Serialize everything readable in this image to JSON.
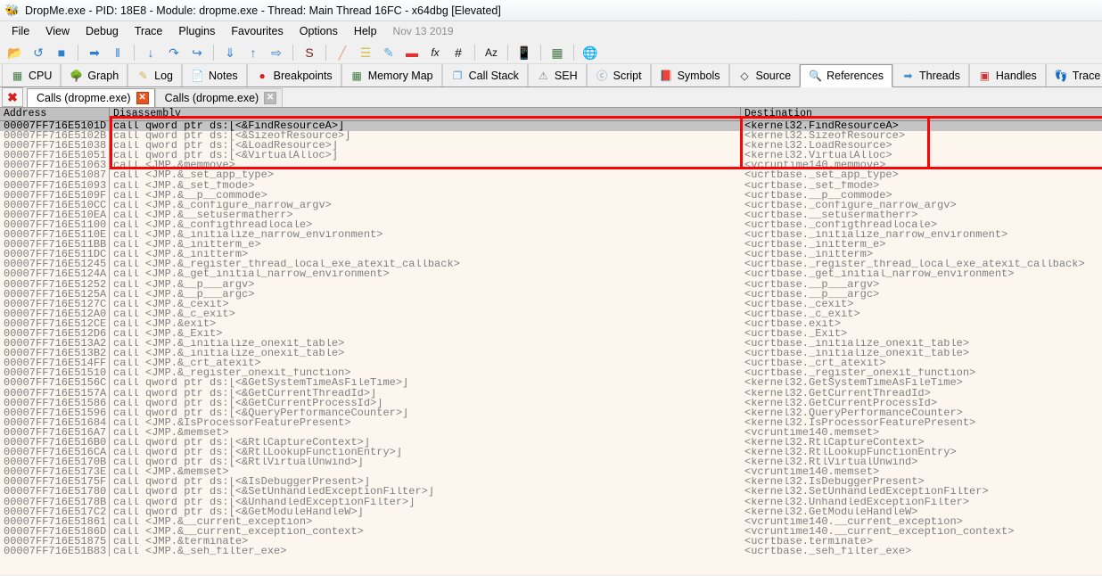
{
  "window": {
    "icon": "bug-icon",
    "title": "DropMe.exe - PID: 18E8 - Module: dropme.exe - Thread: Main Thread 16FC - x64dbg [Elevated]"
  },
  "menubar": {
    "items": [
      "File",
      "View",
      "Debug",
      "Trace",
      "Plugins",
      "Favourites",
      "Options",
      "Help"
    ],
    "date": "Nov 13 2019"
  },
  "toolbar": {
    "buttons": [
      {
        "name": "open-icon",
        "glyph": "📂",
        "color": "#e8b34a"
      },
      {
        "name": "restart-icon",
        "glyph": "↺",
        "color": "#2f7fd0"
      },
      {
        "name": "stop-icon",
        "glyph": "■",
        "color": "#2f7fd0"
      },
      {
        "name": "run-icon",
        "glyph": "➡",
        "color": "#2f7fd0"
      },
      {
        "name": "pause-icon",
        "glyph": "‖",
        "color": "#2f7fd0"
      },
      {
        "name": "step-into-icon",
        "glyph": "↓",
        "color": "#2f7fd0"
      },
      {
        "name": "step-over-icon",
        "glyph": "↷",
        "color": "#2f7fd0"
      },
      {
        "name": "step-out-icon",
        "glyph": "↪",
        "color": "#2f7fd0"
      },
      {
        "name": "run-to-icon",
        "glyph": "⇓",
        "color": "#2f7fd0"
      },
      {
        "name": "execute-till-return-icon",
        "glyph": "↑",
        "color": "#2f7fd0"
      },
      {
        "name": "run-to-user-code-icon",
        "glyph": "⇨",
        "color": "#2f7fd0"
      },
      {
        "name": "scylla-icon",
        "glyph": "S",
        "color": "#7a1b1b"
      },
      {
        "name": "patch-icon",
        "glyph": "╱",
        "color": "#e0a58a"
      },
      {
        "name": "log-window-icon",
        "glyph": "☰",
        "color": "#d8c24a"
      },
      {
        "name": "comment-icon",
        "glyph": "✎",
        "color": "#5aa8d8"
      },
      {
        "name": "bookmark-icon",
        "glyph": "▬",
        "color": "#e03030"
      },
      {
        "name": "function-icon",
        "glyph": "fx",
        "color": "#111111"
      },
      {
        "name": "hash-icon",
        "glyph": "#",
        "color": "#111111"
      },
      {
        "name": "label-icon",
        "glyph": "Az",
        "color": "#111111"
      },
      {
        "name": "attach-icon",
        "glyph": "📱",
        "color": "#6b8db5"
      },
      {
        "name": "calculator-icon",
        "glyph": "▦",
        "color": "#4c7a4c"
      },
      {
        "name": "globe-icon",
        "glyph": "🌐",
        "color": "#2f7fd0"
      }
    ],
    "separators_after": [
      2,
      4,
      7,
      10,
      11,
      17,
      18,
      19,
      20
    ]
  },
  "tabs": {
    "items": [
      {
        "label": "CPU",
        "icon": "cpu-icon",
        "glyph": "▦",
        "color": "#3f7a3f",
        "active": false
      },
      {
        "label": "Graph",
        "icon": "graph-tree-icon",
        "glyph": "🌳",
        "color": "#3f9a3f",
        "active": false
      },
      {
        "label": "Log",
        "icon": "log-icon",
        "glyph": "✎",
        "color": "#d8b24a",
        "active": false
      },
      {
        "label": "Notes",
        "icon": "notes-icon",
        "glyph": "📄",
        "color": "#8fb4d8",
        "active": false
      },
      {
        "label": "Breakpoints",
        "icon": "breakpoint-icon",
        "glyph": "●",
        "color": "#d02020",
        "active": false
      },
      {
        "label": "Memory Map",
        "icon": "memory-map-icon",
        "glyph": "▦",
        "color": "#3f7a3f",
        "active": false
      },
      {
        "label": "Call Stack",
        "icon": "call-stack-icon",
        "glyph": "❐",
        "color": "#5a9ed8",
        "active": false
      },
      {
        "label": "SEH",
        "icon": "seh-icon",
        "glyph": "⚠",
        "color": "#8a8a8a",
        "active": false
      },
      {
        "label": "Script",
        "icon": "script-icon",
        "glyph": "ⓒ",
        "color": "#7a9ab5",
        "active": false
      },
      {
        "label": "Symbols",
        "icon": "symbols-icon",
        "glyph": "📕",
        "color": "#d03030",
        "active": false
      },
      {
        "label": "Source",
        "icon": "source-icon",
        "glyph": "◇",
        "color": "#333333",
        "active": false
      },
      {
        "label": "References",
        "icon": "references-magnifier-icon",
        "glyph": "🔍",
        "color": "#6a6a6a",
        "active": true
      },
      {
        "label": "Threads",
        "icon": "threads-icon",
        "glyph": "➡",
        "color": "#3f8fd0",
        "active": false
      },
      {
        "label": "Handles",
        "icon": "handles-icon",
        "glyph": "▣",
        "color": "#d03030",
        "active": false
      },
      {
        "label": "Trace",
        "icon": "trace-footprint-icon",
        "glyph": "👣",
        "color": "#555555",
        "active": false
      }
    ]
  },
  "subtabs": {
    "close_all_icon": "close-all-icon",
    "close_all_glyph": "✖",
    "items": [
      {
        "label": "Calls (dropme.exe)",
        "active": true,
        "close_color": "red"
      },
      {
        "label": "Calls (dropme.exe)",
        "active": false,
        "close_color": "gray"
      }
    ]
  },
  "table": {
    "columns": [
      "Address",
      "Disassembly",
      "Destination"
    ],
    "selected_index": 0,
    "rows": [
      {
        "address": "00007FF716E5101D",
        "disassembly": "call qword ptr ds:[<&FindResourceA>]",
        "destination": "<kernel32.FindResourceA>"
      },
      {
        "address": "00007FF716E5102B",
        "disassembly": "call qword ptr ds:[<&SizeofResource>]",
        "destination": "<kernel32.SizeofResource>"
      },
      {
        "address": "00007FF716E51038",
        "disassembly": "call qword ptr ds:[<&LoadResource>]",
        "destination": "<kernel32.LoadResource>"
      },
      {
        "address": "00007FF716E51051",
        "disassembly": "call qword ptr ds:[<&VirtualAlloc>]",
        "destination": "<kernel32.VirtualAlloc>"
      },
      {
        "address": "00007FF716E51063",
        "disassembly": "call <JMP.&memmove>",
        "destination": "<vcruntime140.memmove>"
      },
      {
        "address": "00007FF716E51087",
        "disassembly": "call <JMP.&_set_app_type>",
        "destination": "<ucrtbase._set_app_type>"
      },
      {
        "address": "00007FF716E51093",
        "disassembly": "call <JMP.&_set_fmode>",
        "destination": "<ucrtbase._set_fmode>"
      },
      {
        "address": "00007FF716E5109F",
        "disassembly": "call <JMP.&__p__commode>",
        "destination": "<ucrtbase.__p__commode>"
      },
      {
        "address": "00007FF716E510CC",
        "disassembly": "call <JMP.&_configure_narrow_argv>",
        "destination": "<ucrtbase._configure_narrow_argv>"
      },
      {
        "address": "00007FF716E510EA",
        "disassembly": "call <JMP.&__setusermatherr>",
        "destination": "<ucrtbase.__setusermatherr>"
      },
      {
        "address": "00007FF716E51100",
        "disassembly": "call <JMP.&_configthreadlocale>",
        "destination": "<ucrtbase._configthreadlocale>"
      },
      {
        "address": "00007FF716E5110E",
        "disassembly": "call <JMP.&_initialize_narrow_environment>",
        "destination": "<ucrtbase._initialize_narrow_environment>"
      },
      {
        "address": "00007FF716E511BB",
        "disassembly": "call <JMP.&_initterm_e>",
        "destination": "<ucrtbase._initterm_e>"
      },
      {
        "address": "00007FF716E511DC",
        "disassembly": "call <JMP.&_initterm>",
        "destination": "<ucrtbase._initterm>"
      },
      {
        "address": "00007FF716E51245",
        "disassembly": "call <JMP.&_register_thread_local_exe_atexit_callback>",
        "destination": "<ucrtbase._register_thread_local_exe_atexit_callback>"
      },
      {
        "address": "00007FF716E5124A",
        "disassembly": "call <JMP.&_get_initial_narrow_environment>",
        "destination": "<ucrtbase._get_initial_narrow_environment>"
      },
      {
        "address": "00007FF716E51252",
        "disassembly": "call <JMP.&__p___argv>",
        "destination": "<ucrtbase.__p___argv>"
      },
      {
        "address": "00007FF716E5125A",
        "disassembly": "call <JMP.&__p___argc>",
        "destination": "<ucrtbase.__p___argc>"
      },
      {
        "address": "00007FF716E5127C",
        "disassembly": "call <JMP.&_cexit>",
        "destination": "<ucrtbase._cexit>"
      },
      {
        "address": "00007FF716E512A0",
        "disassembly": "call <JMP.&_c_exit>",
        "destination": "<ucrtbase._c_exit>"
      },
      {
        "address": "00007FF716E512CE",
        "disassembly": "call <JMP.&exit>",
        "destination": "<ucrtbase.exit>"
      },
      {
        "address": "00007FF716E512D6",
        "disassembly": "call <JMP.&_Exit>",
        "destination": "<ucrtbase._Exit>"
      },
      {
        "address": "00007FF716E513A2",
        "disassembly": "call <JMP.&_initialize_onexit_table>",
        "destination": "<ucrtbase._initialize_onexit_table>"
      },
      {
        "address": "00007FF716E513B2",
        "disassembly": "call <JMP.&_initialize_onexit_table>",
        "destination": "<ucrtbase._initialize_onexit_table>"
      },
      {
        "address": "00007FF716E514FF",
        "disassembly": "call <JMP.&_crt_atexit>",
        "destination": "<ucrtbase._crt_atexit>"
      },
      {
        "address": "00007FF716E51510",
        "disassembly": "call <JMP.&_register_onexit_function>",
        "destination": "<ucrtbase._register_onexit_function>"
      },
      {
        "address": "00007FF716E5156C",
        "disassembly": "call qword ptr ds:[<&GetSystemTimeAsFileTime>]",
        "destination": "<kernel32.GetSystemTimeAsFileTime>"
      },
      {
        "address": "00007FF716E5157A",
        "disassembly": "call qword ptr ds:[<&GetCurrentThreadId>]",
        "destination": "<kernel32.GetCurrentThreadId>"
      },
      {
        "address": "00007FF716E51586",
        "disassembly": "call qword ptr ds:[<&GetCurrentProcessId>]",
        "destination": "<kernel32.GetCurrentProcessId>"
      },
      {
        "address": "00007FF716E51596",
        "disassembly": "call qword ptr ds:[<&QueryPerformanceCounter>]",
        "destination": "<kernel32.QueryPerformanceCounter>"
      },
      {
        "address": "00007FF716E51684",
        "disassembly": "call <JMP.&IsProcessorFeaturePresent>",
        "destination": "<kernel32.IsProcessorFeaturePresent>"
      },
      {
        "address": "00007FF716E516A7",
        "disassembly": "call <JMP.&memset>",
        "destination": "<vcruntime140.memset>"
      },
      {
        "address": "00007FF716E516B0",
        "disassembly": "call qword ptr ds:[<&RtlCaptureContext>]",
        "destination": "<kernel32.RtlCaptureContext>"
      },
      {
        "address": "00007FF716E516CA",
        "disassembly": "call qword ptr ds:[<&RtlLookupFunctionEntry>]",
        "destination": "<kernel32.RtlLookupFunctionEntry>"
      },
      {
        "address": "00007FF716E5170B",
        "disassembly": "call qword ptr ds:[<&RtlVirtualUnwind>]",
        "destination": "<kernel32.RtlVirtualUnwind>"
      },
      {
        "address": "00007FF716E5173E",
        "disassembly": "call <JMP.&memset>",
        "destination": "<vcruntime140.memset>"
      },
      {
        "address": "00007FF716E5175F",
        "disassembly": "call qword ptr ds:[<&IsDebuggerPresent>]",
        "destination": "<kernel32.IsDebuggerPresent>"
      },
      {
        "address": "00007FF716E51780",
        "disassembly": "call qword ptr ds:[<&SetUnhandledExceptionFilter>]",
        "destination": "<kernel32.SetUnhandledExceptionFilter>"
      },
      {
        "address": "00007FF716E5178B",
        "disassembly": "call qword ptr ds:[<&UnhandledExceptionFilter>]",
        "destination": "<kernel32.UnhandledExceptionFilter>"
      },
      {
        "address": "00007FF716E517C2",
        "disassembly": "call qword ptr ds:[<&GetModuleHandleW>]",
        "destination": "<kernel32.GetModuleHandleW>"
      },
      {
        "address": "00007FF716E51861",
        "disassembly": "call <JMP.&__current_exception>",
        "destination": "<vcruntime140.__current_exception>"
      },
      {
        "address": "00007FF716E5186D",
        "disassembly": "call <JMP.&__current_exception_context>",
        "destination": "<vcruntime140.__current_exception_context>"
      },
      {
        "address": "00007FF716E51875",
        "disassembly": "call <JMP.&terminate>",
        "destination": "<ucrtbase.terminate>"
      },
      {
        "address": "00007FF716E51B83",
        "disassembly": "call <JMP.&_seh_filter_exe>",
        "destination": "<ucrtbase._seh_filter_exe>"
      }
    ]
  },
  "annotation": {
    "name": "red-highlight-rectangle",
    "color": "#f60606",
    "covers_rows": 5
  }
}
